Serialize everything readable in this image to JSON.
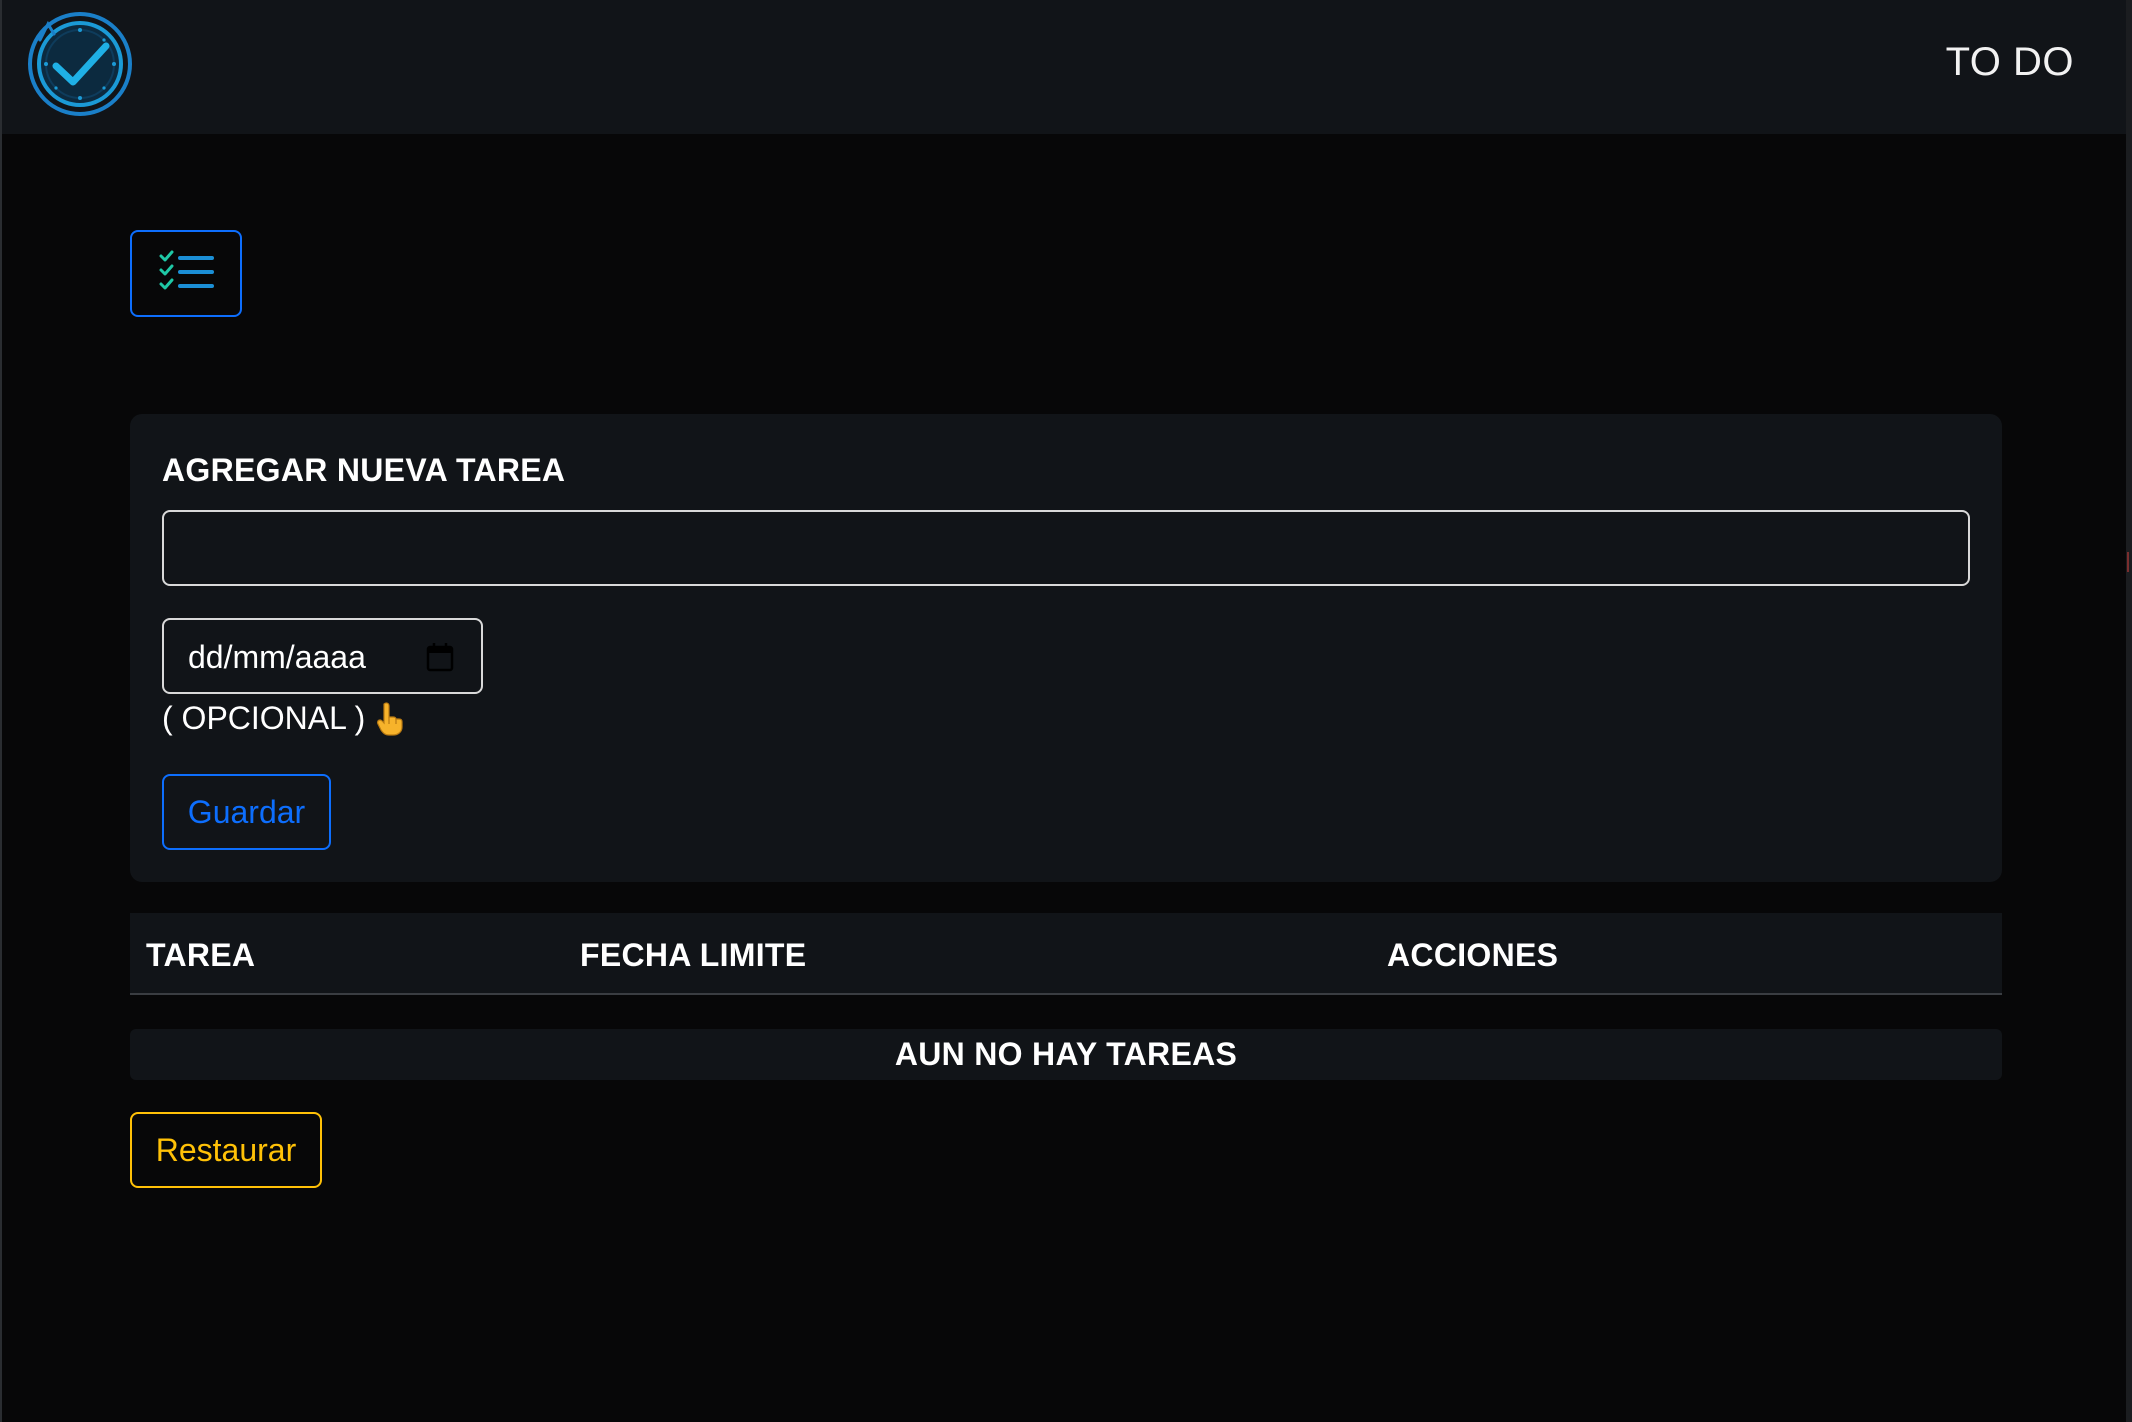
{
  "navbar": {
    "brand": "TO DO",
    "logo_icon": "clock-check-icon"
  },
  "toolbar": {
    "list_toggle_icon": "checklist-icon"
  },
  "form": {
    "title": "AGREGAR NUEVA TAREA",
    "task_value": "",
    "date_placeholder": "dd/mm/aaaa",
    "optional_label": "( OPCIONAL )",
    "optional_icon": "pointing-hand-icon",
    "save_label": "Guardar"
  },
  "table": {
    "columns": [
      "TAREA",
      "FECHA LIMITE",
      "ACCIONES"
    ],
    "empty_message": "AUN NO HAY TAREAS"
  },
  "actions": {
    "restore_label": "Restaurar"
  },
  "colors": {
    "primary": "#0d6efd",
    "warning": "#ffc107",
    "accent_teal": "#1fc8a6",
    "logo_blue": "#1b8fd6",
    "surface": "#111418",
    "background": "#070708"
  }
}
